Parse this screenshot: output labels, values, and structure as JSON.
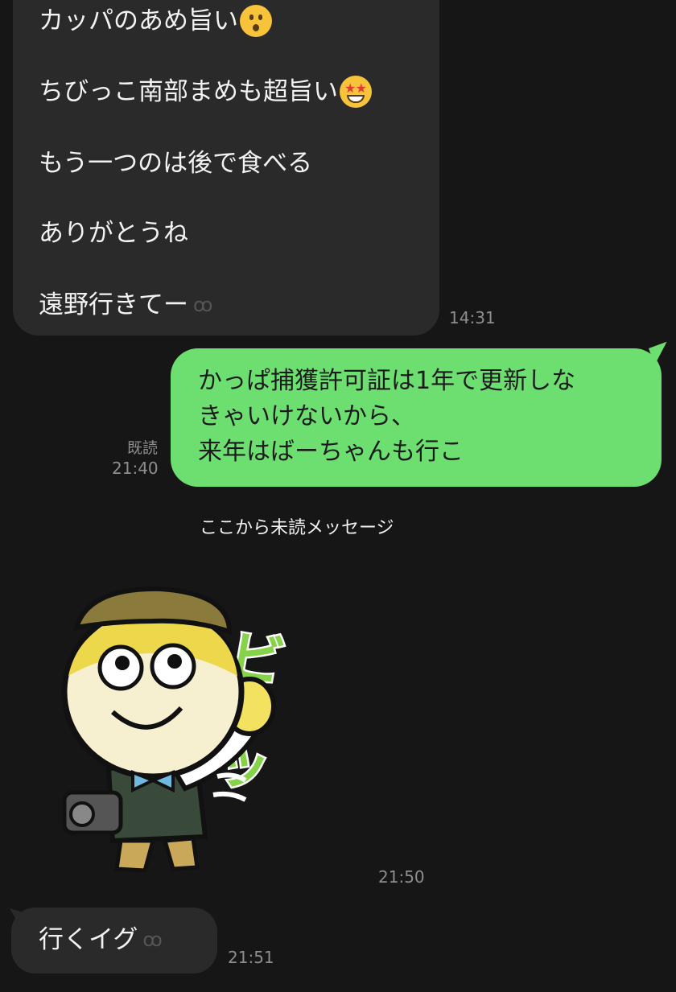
{
  "top_bubble": {
    "lines": [
      "カッパのあめ旨い",
      "ちびっこ南部まめも超旨い",
      "もう一つのは後で食べる",
      "ありがとうね",
      "遠野行きてー"
    ],
    "emoji_names": [
      "hushed-face-icon",
      "star-struck-face-icon"
    ],
    "read_glyph": "ꝏ",
    "time": "14:31"
  },
  "out_bubble": {
    "lines": [
      "かっぱ捕獲許可証は1年で更新しな",
      "きゃいけないから、",
      "来年はばーちゃんも行こ"
    ],
    "read_label": "既読",
    "time": "21:40",
    "color": "#6ddf71"
  },
  "divider": {
    "label": "ここから未読メッセージ"
  },
  "sticker": {
    "caption": "ビシッ",
    "time": "21:50"
  },
  "small_bubble": {
    "text": "行くイグ",
    "read_glyph": "ꝏ",
    "time": "21:51"
  }
}
